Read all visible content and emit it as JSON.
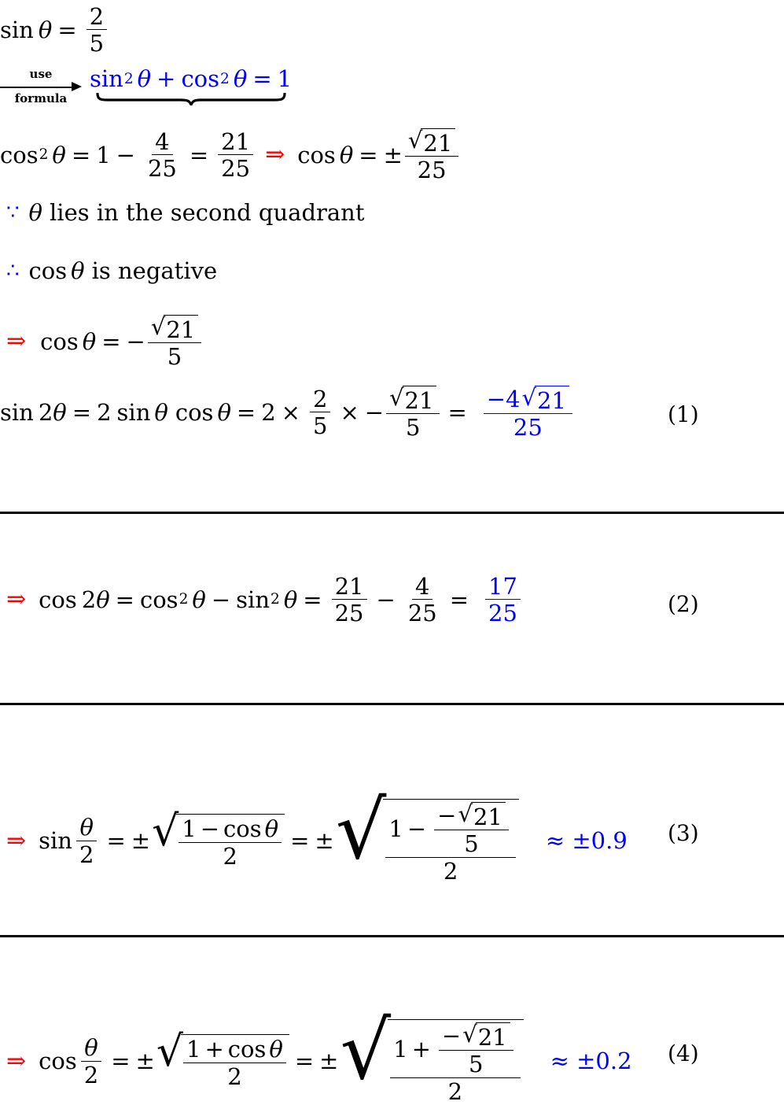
{
  "document": {
    "type": "math-worksheet",
    "text_color": "#000000",
    "highlight_color": "#0000ff",
    "implication_color": "#ff0000",
    "background": "#ffffff"
  },
  "line1": {
    "lhs_fn": "sin",
    "lhs_var": "θ",
    "equals": "=",
    "frac_num": "2",
    "frac_den": "5"
  },
  "line2": {
    "arrow_label_top": "use",
    "arrow_label_bottom": "formula",
    "identity_sin": "sin",
    "identity_sin_exp": "2",
    "identity_var1": "θ",
    "identity_plus": "+",
    "identity_cos": "cos",
    "identity_cos_exp": "2",
    "identity_var2": "θ",
    "identity_equals": "=",
    "identity_rhs": "1"
  },
  "line3": {
    "cos": "cos",
    "cos_exp": "2",
    "var": "θ",
    "eq1": "=",
    "one": "1",
    "minus": "−",
    "f1_num": "4",
    "f1_den": "25",
    "eq2": "=",
    "f2_num": "21",
    "f2_den": "25",
    "implies": "⇒",
    "cos2": "cos",
    "var2": "θ",
    "eq3": "=",
    "pm": "±",
    "f3_num_root": "21",
    "f3_den": "25"
  },
  "line4": {
    "symbol": "∵",
    "text_var": "θ",
    "text": "lies in the second quadrant"
  },
  "line5": {
    "symbol": "∴",
    "fn": "cos",
    "var": "θ",
    "text": "is negative"
  },
  "line6": {
    "implies": "⇒",
    "fn": "cos",
    "var": "θ",
    "equals": "=",
    "minus": "−",
    "num_root": "21",
    "den": "5"
  },
  "eq1_line": {
    "lhs_fn": "sin",
    "lhs_coef": "2",
    "lhs_var": "θ",
    "eq1": "=",
    "two": "2",
    "sin": "sin",
    "var_a": "θ",
    "cos": "cos",
    "var_b": "θ",
    "eq2": "=",
    "factor": "2",
    "times1": "×",
    "f1_num": "2",
    "f1_den": "5",
    "times2": "×",
    "minus": "−",
    "f2_num_root": "21",
    "f2_den": "5",
    "eq3": "=",
    "result_num_coef": "−4",
    "result_num_root": "21",
    "result_den": "25",
    "number": "(1)"
  },
  "eq2_line": {
    "implies": "⇒",
    "cos": "cos",
    "coef": "2",
    "var": "θ",
    "eq1": "=",
    "cos2": "cos",
    "cos2_exp": "2",
    "var2": "θ",
    "minus": "−",
    "sin2": "sin",
    "sin2_exp": "2",
    "var3": "θ",
    "eq2": "=",
    "f1_num": "21",
    "f1_den": "25",
    "minus2": "−",
    "f2_num": "4",
    "f2_den": "25",
    "eq3": "=",
    "result_num": "17",
    "result_den": "25",
    "number": "(2)"
  },
  "eq3_line": {
    "implies": "⇒",
    "sin": "sin",
    "half_num": "θ",
    "half_den": "2",
    "eq1": "=",
    "pm1": "±",
    "r1_num_one": "1",
    "r1_num_minus": "−",
    "r1_num_cos": "cos",
    "r1_num_var": "θ",
    "r1_den": "2",
    "eq2": "=",
    "pm2": "±",
    "r2_num_one": "1",
    "r2_num_minus": "−",
    "r2_inner_minus": "−",
    "r2_inner_root": "21",
    "r2_inner_den": "5",
    "r2_den": "2",
    "approx": "≈ ±0.9",
    "number": "(3)"
  },
  "eq4_line": {
    "implies": "⇒",
    "cos": "cos",
    "half_num": "θ",
    "half_den": "2",
    "eq1": "=",
    "pm1": "±",
    "r1_num_one": "1",
    "r1_num_plus": "+",
    "r1_num_cos": "cos",
    "r1_num_var": "θ",
    "r1_den": "2",
    "eq2": "=",
    "pm2": "±",
    "r2_num_one": "1",
    "r2_num_plus": "+",
    "r2_inner_minus": "−",
    "r2_inner_root": "21",
    "r2_inner_den": "5",
    "r2_den": "2",
    "approx": "≈ ±0.2",
    "number": "(4)"
  }
}
